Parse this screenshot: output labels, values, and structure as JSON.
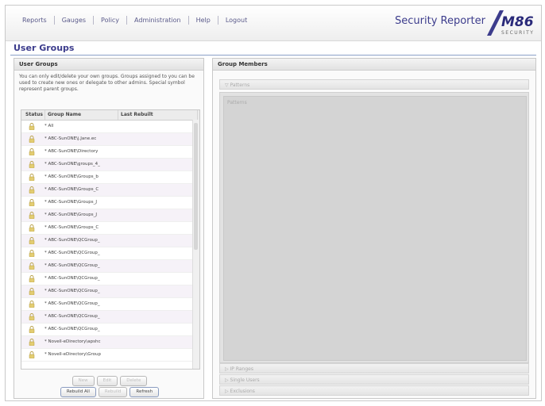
{
  "nav": [
    "Reports",
    "Gauges",
    "Policy",
    "Administration",
    "Help",
    "Logout"
  ],
  "brand": {
    "title": "Security Reporter",
    "logo_text": "M86",
    "logo_sub": "SECURITY"
  },
  "page_title": "User Groups",
  "left": {
    "header": "User Groups",
    "description": "You can only edit/delete your own groups. Groups assigned to you can be used to create new ones or delegate to other admins. Special symbol represent parent groups.",
    "columns": [
      "Status",
      "Group Name",
      "Last Rebuilt"
    ],
    "rows": [
      {
        "name": "* All"
      },
      {
        "name": "* ABC-SunONE\\j.Jane.ec"
      },
      {
        "name": "* ABC-SunONE\\Directory"
      },
      {
        "name": "* ABC-SunONE\\groups_4_"
      },
      {
        "name": "* ABC-SunONE\\Groups_b"
      },
      {
        "name": "* ABC-SunONE\\Groups_C"
      },
      {
        "name": "* ABC-SunONE\\Groups_J"
      },
      {
        "name": "* ABC-SunONE\\Groups_J"
      },
      {
        "name": "* ABC-SunONE\\Groups_C"
      },
      {
        "name": "* ABC-SunONE\\QCGroup_"
      },
      {
        "name": "* ABC-SunONE\\QCGroup_"
      },
      {
        "name": "* ABC-SunONE\\QCGroup_"
      },
      {
        "name": "* ABC-SunONE\\QCGroup_"
      },
      {
        "name": "* ABC-SunONE\\QCGroup_"
      },
      {
        "name": "* ABC-SunONE\\QCGroup_"
      },
      {
        "name": "* ABC-SunONE\\QCGroup_"
      },
      {
        "name": "* ABC-SunONE\\QCGroup_"
      },
      {
        "name": "* Novell-eDirectory\\apshc"
      },
      {
        "name": "* Novell-eDirectory\\Group"
      }
    ],
    "buttons_row1": [
      "New",
      "Edit",
      "Delete"
    ],
    "buttons_row2": [
      "Rebuild All",
      "Rebuild",
      "Refresh"
    ]
  },
  "right": {
    "header": "Group Members",
    "sections": [
      "Patterns",
      "IP Ranges",
      "Single Users",
      "Exclusions"
    ],
    "inner_label": "Patterns"
  },
  "colors": {
    "accent": "#3c3c8c",
    "rule": "#8aa0c8"
  }
}
